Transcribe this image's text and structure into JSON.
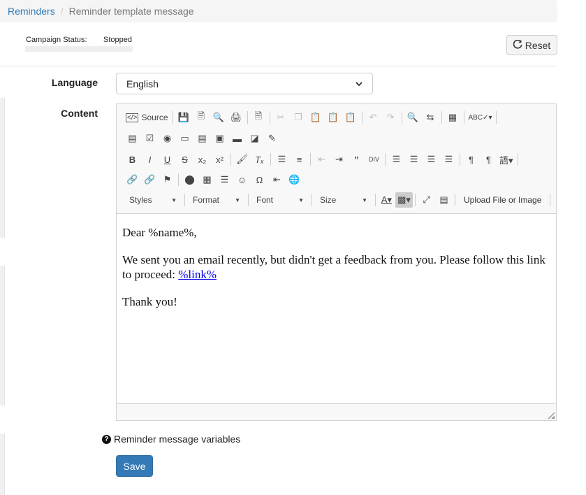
{
  "breadcrumb": {
    "root": "Reminders",
    "separator": "/",
    "current": "Reminder template message"
  },
  "status": {
    "label": "Campaign Status:",
    "value": "Stopped"
  },
  "reset_button": {
    "label": "Reset"
  },
  "form": {
    "language_label": "Language",
    "language_value": "English",
    "content_label": "Content"
  },
  "toolbar": {
    "source_label": "Source",
    "styles_label": "Styles",
    "format_label": "Format",
    "font_label": "Font",
    "size_label": "Size",
    "upload_label": "Upload File or Image"
  },
  "content": {
    "greeting": "Dear %name%,",
    "body": "We sent you an email recently, but didn't get a feedback from you. Please follow this link to proceed: ",
    "link_text": "%link%",
    "closing": "Thank you!"
  },
  "variables_link": "Reminder message variables",
  "save_button": {
    "label": "Save"
  },
  "colors": {
    "primary": "#337ab7",
    "link": "#337ab7",
    "breadcrumb_bg": "#f5f5f5"
  }
}
